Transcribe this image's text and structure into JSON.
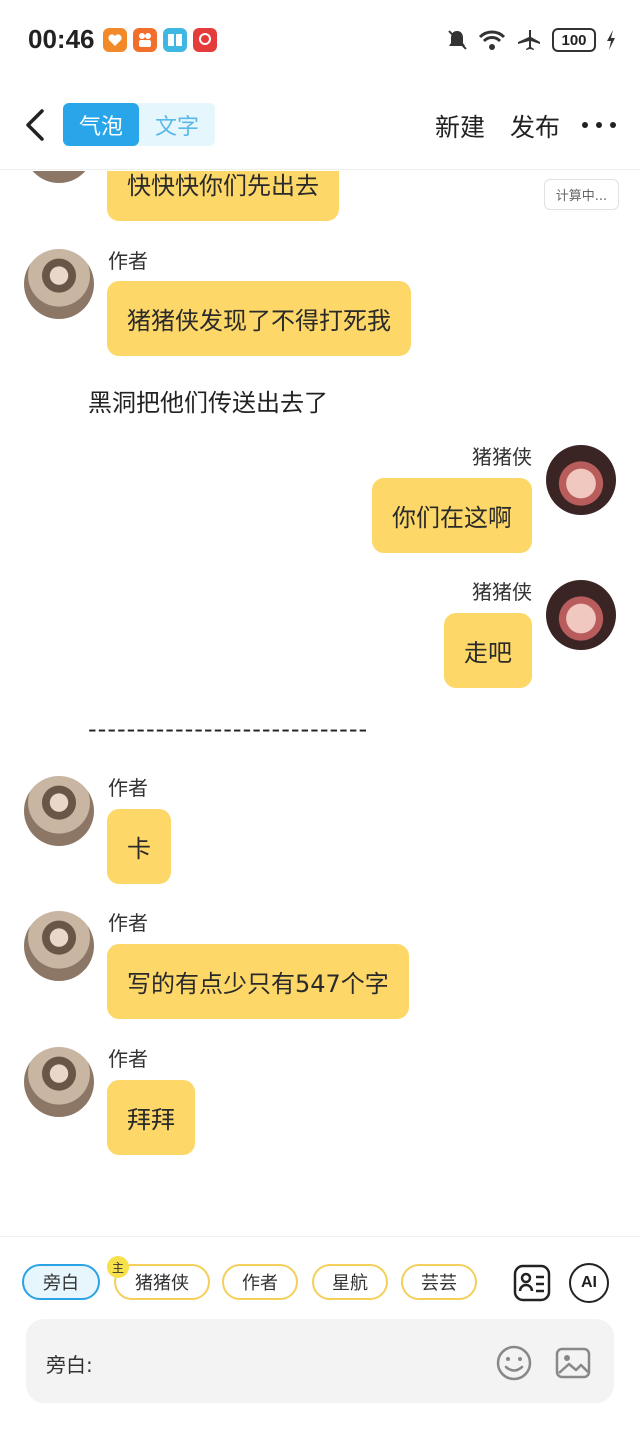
{
  "status_bar": {
    "time": "00:46",
    "app_badges": [
      {
        "icon": "heart-app-icon",
        "color": "#f38a2a"
      },
      {
        "icon": "kuaishou-app-icon",
        "color": "#f26f2b"
      },
      {
        "icon": "book-app-icon",
        "color": "#3fb7e3"
      },
      {
        "icon": "shopping-app-icon",
        "color": "#e53b3b"
      }
    ],
    "battery": "100"
  },
  "header": {
    "tabs": [
      {
        "label": "气泡",
        "active": true
      },
      {
        "label": "文字",
        "active": false
      }
    ],
    "new_label": "新建",
    "publish_label": "发布"
  },
  "chat": {
    "calc_badge": "计算中...",
    "messages": [
      {
        "type": "bubble",
        "side": "left",
        "speaker": "",
        "text": "快快快你们先出去"
      },
      {
        "type": "bubble",
        "side": "left",
        "speaker": "作者",
        "text": "猪猪侠发现了不得打死我"
      },
      {
        "type": "narration",
        "text": "黑洞把他们传送出去了"
      },
      {
        "type": "bubble",
        "side": "right",
        "speaker": "猪猪侠",
        "text": "你们在这啊"
      },
      {
        "type": "bubble",
        "side": "right",
        "speaker": "猪猪侠",
        "text": "走吧"
      },
      {
        "type": "narration",
        "text": "-----------------------------"
      },
      {
        "type": "bubble",
        "side": "left",
        "speaker": "作者",
        "text": "卡"
      },
      {
        "type": "bubble",
        "side": "left",
        "speaker": "作者",
        "text": "写的有点少只有547个字"
      },
      {
        "type": "bubble",
        "side": "left",
        "speaker": "作者",
        "text": "拜拜"
      }
    ]
  },
  "bottom": {
    "roles": [
      {
        "label": "旁白",
        "active": true
      },
      {
        "label": "猪猪侠",
        "active": false,
        "badge": "主"
      },
      {
        "label": "作者",
        "active": false
      },
      {
        "label": "星航",
        "active": false
      },
      {
        "label": "芸芸",
        "active": false
      }
    ],
    "ai_label": "AI",
    "input_label": "旁白:"
  },
  "colors": {
    "accent": "#29a6ea",
    "bubble": "#fdd868",
    "chip_border": "#f5cf5a"
  }
}
